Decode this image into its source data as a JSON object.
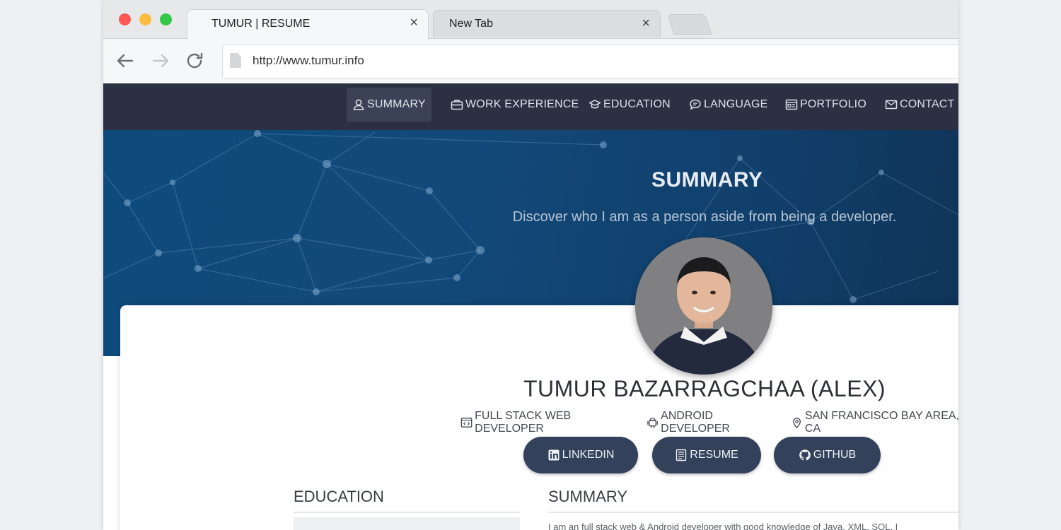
{
  "browser": {
    "tabs": [
      {
        "label": "TUMUR | RESUME",
        "active": true
      },
      {
        "label": "New Tab",
        "active": false
      }
    ],
    "tab_close_glyph": "×",
    "url": "http://www.tumur.info",
    "icons": [
      "arrow-left-icon",
      "arrow-right-icon",
      "reload-icon",
      "page-icon"
    ]
  },
  "nav": {
    "items": [
      {
        "label": "SUMMARY",
        "icon": "user-icon",
        "active": true
      },
      {
        "label": "WORK EXPERIENCE",
        "icon": "briefcase-icon"
      },
      {
        "label": "EDUCATION",
        "icon": "graduation-cap-icon"
      },
      {
        "label": "LANGUAGE",
        "icon": "chat-icon"
      },
      {
        "label": "PORTFOLIO",
        "icon": "portfolio-icon"
      },
      {
        "label": "CONTACT",
        "icon": "envelope-icon"
      }
    ]
  },
  "hero": {
    "title": "SUMMARY",
    "subtitle": "Discover who I am as a person aside from being a developer."
  },
  "profile": {
    "name": "TUMUR BAZARRAGCHAA (ALEX)",
    "tags": [
      {
        "label": "FULL STACK WEB DEVELOPER",
        "icon": "code-window-icon"
      },
      {
        "label": "ANDROID DEVELOPER",
        "icon": "android-icon"
      },
      {
        "label": "SAN FRANCISCO BAY AREA, CA",
        "icon": "location-pin-icon"
      }
    ],
    "buttons": [
      {
        "label": "LINKEDIN",
        "icon": "linkedin-icon"
      },
      {
        "label": "RESUME",
        "icon": "document-icon"
      },
      {
        "label": "GITHUB",
        "icon": "github-icon"
      }
    ]
  },
  "sections": {
    "education_heading": "EDUCATION",
    "summary_heading": "SUMMARY",
    "summary_text": "I am an full stack web & Android developer with good knowledge of Java, XML, SQL, I"
  },
  "colors": {
    "navbar": "#2b3042",
    "hero": "#12497a",
    "button": "#33415a"
  }
}
